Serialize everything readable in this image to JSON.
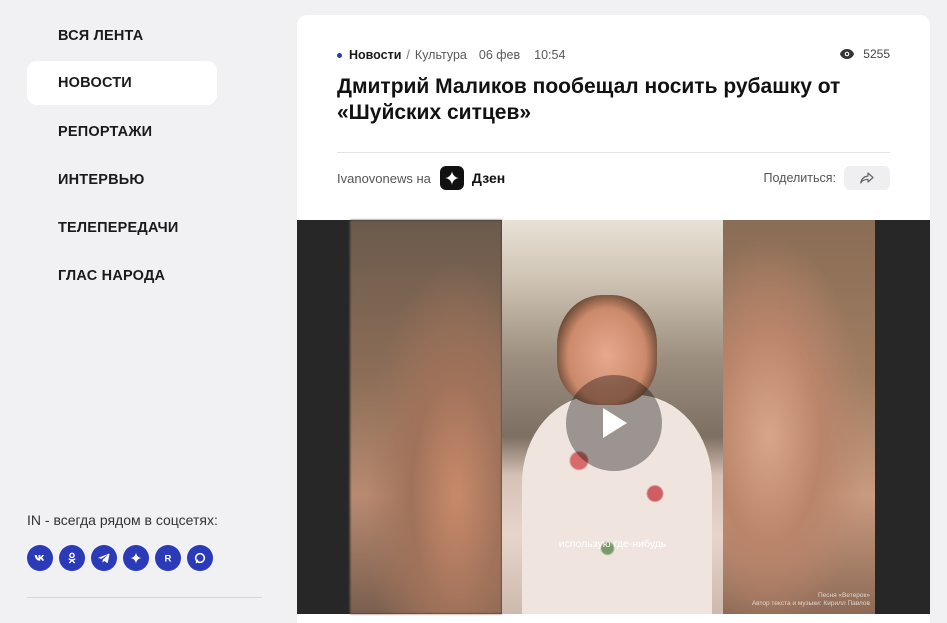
{
  "sidebar": {
    "items": [
      {
        "label": "ВСЯ ЛЕНТА",
        "active": false
      },
      {
        "label": "НОВОСТИ",
        "active": true
      },
      {
        "label": "РЕПОРТАЖИ",
        "active": false
      },
      {
        "label": "ИНТЕРВЬЮ",
        "active": false
      },
      {
        "label": "ТЕЛЕПЕРЕДАЧИ",
        "active": false
      },
      {
        "label": "ГЛАС НАРОДА",
        "active": false
      }
    ],
    "social_title": "IN - всегда рядом в соцсетях:",
    "social_icons": [
      "vk-icon",
      "odnoklassniki-icon",
      "telegram-icon",
      "dzen-icon",
      "rutube-icon",
      "max-icon"
    ]
  },
  "article": {
    "category": "Новости",
    "separator": "/",
    "subcategory": "Культура",
    "date": "06 фев",
    "time": "10:54",
    "views": "5255",
    "title": "Дмитрий Маликов пообещал носить рубашку от «Шуйских ситцев»",
    "source_text": "Ivanovonews на",
    "dzen_label": "Дзен",
    "share_label": "Поделиться:"
  },
  "video": {
    "subtitle": "использую где-нибудь",
    "credit_line1": "Песня «Ветерок»",
    "credit_line2": "Автор текста и музыки: Кирилл Павлов"
  },
  "colors": {
    "accent": "#2a3ab8",
    "background": "#f1f1f3",
    "card": "#ffffff"
  }
}
